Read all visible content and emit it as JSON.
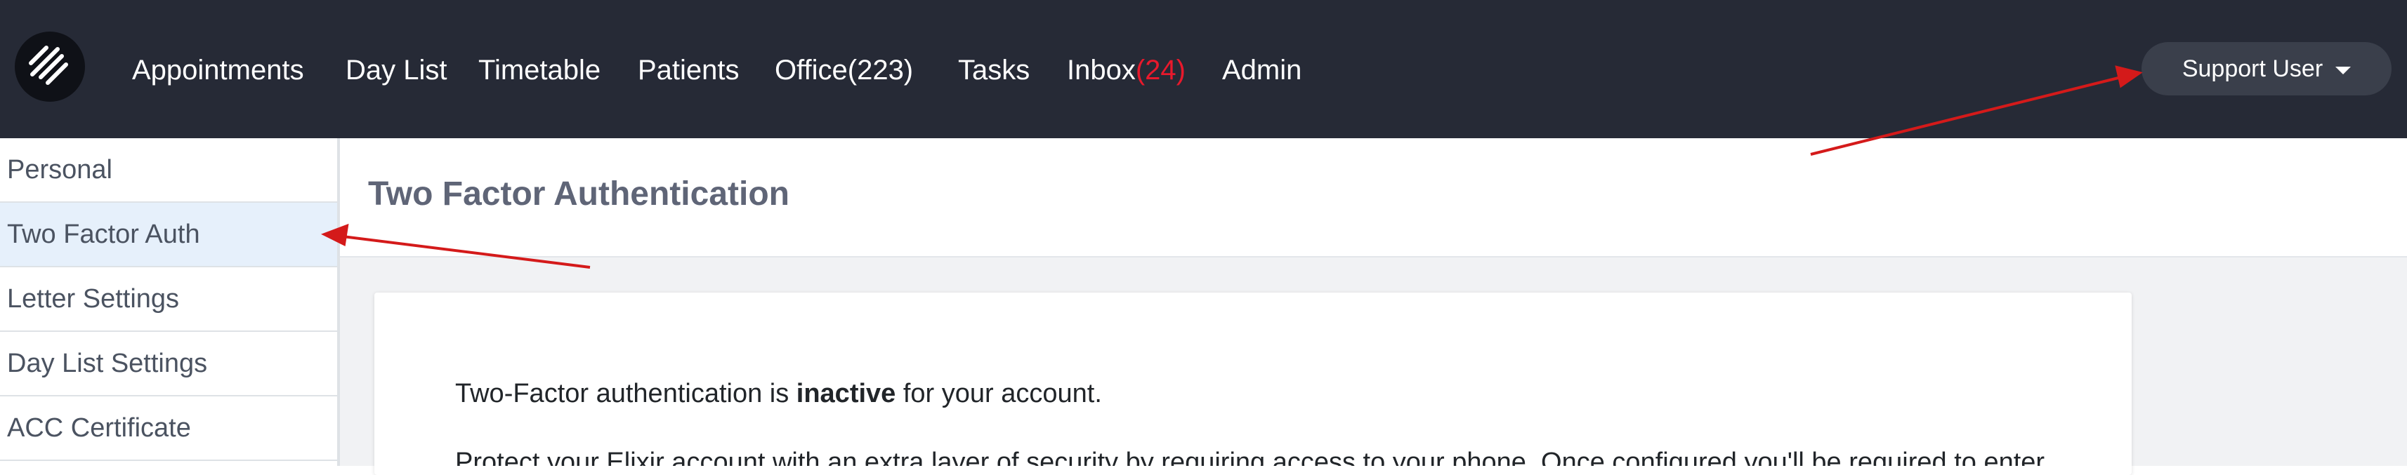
{
  "nav": {
    "items": [
      {
        "label": "Appointments"
      },
      {
        "label": "Day List"
      },
      {
        "label": "Timetable"
      },
      {
        "label": "Patients"
      },
      {
        "label": "Office(223)"
      },
      {
        "label": "Tasks"
      },
      {
        "label": "Inbox",
        "badge": "(24)"
      },
      {
        "label": "Admin"
      }
    ],
    "user_label": "Support User",
    "logo_icon": "brand-stripes-icon"
  },
  "sidebar": {
    "items": [
      {
        "label": "Personal"
      },
      {
        "label": "Two Factor Auth",
        "active": true
      },
      {
        "label": "Letter Settings"
      },
      {
        "label": "Day List Settings"
      },
      {
        "label": "ACC Certificate"
      }
    ]
  },
  "main": {
    "title": "Two Factor Authentication",
    "status_prefix": "Two-Factor authentication is ",
    "status_value": "inactive",
    "status_suffix": " for your account.",
    "description": "Protect your Elixir account with an extra layer of security by requiring access to your phone. Once configured you'll be required to enter"
  },
  "colors": {
    "topbar": "#262a36",
    "badge": "#e8192c",
    "active_item": "#e6f0fb",
    "annotation_arrow": "#d41a1a"
  }
}
